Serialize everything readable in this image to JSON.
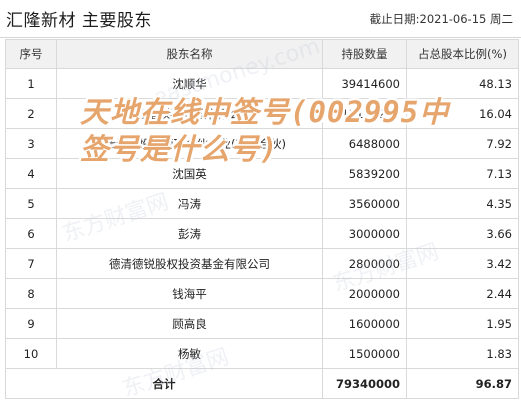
{
  "header": {
    "title": "汇隆新材 主要股东",
    "date": "截止日期:2021-06-15 周二"
  },
  "table": {
    "columns": [
      "序号",
      "股东名称",
      "持股数量",
      "占总股本比例(%)"
    ],
    "rows": [
      {
        "rank": "1",
        "name": "沈顺华",
        "shares": "39414600",
        "ratio": "48.13"
      },
      {
        "rank": "2",
        "name": "浙江省英汇控股有限公司",
        "shares": "13138200",
        "ratio": "16.04"
      },
      {
        "rank": "3",
        "name": "德清汇隆投资管理合伙企业(有限合伙)",
        "shares": "6488000",
        "ratio": "7.92"
      },
      {
        "rank": "4",
        "name": "沈国英",
        "shares": "5839200",
        "ratio": "7.13"
      },
      {
        "rank": "5",
        "name": "冯涛",
        "shares": "3560000",
        "ratio": "4.35"
      },
      {
        "rank": "6",
        "name": "彭涛",
        "shares": "3000000",
        "ratio": "3.66"
      },
      {
        "rank": "7",
        "name": "德清德锐股权投资基金有限公司",
        "shares": "2800000",
        "ratio": "3.42"
      },
      {
        "rank": "8",
        "name": "钱海平",
        "shares": "2000000",
        "ratio": "2.44"
      },
      {
        "rank": "9",
        "name": "顾高良",
        "shares": "1600000",
        "ratio": "1.95"
      },
      {
        "rank": "10",
        "name": "杨敏",
        "shares": "1500000",
        "ratio": "1.83"
      }
    ],
    "total": {
      "label": "合计",
      "shares": "79340000",
      "ratio": "96.87"
    }
  },
  "overlay": {
    "text": "天地在线中签号(002995中签号是什么号)",
    "color": "#e6a56c"
  },
  "watermark": {
    "text_cn": "东方财富网",
    "text_en": "eastmoney.com"
  }
}
